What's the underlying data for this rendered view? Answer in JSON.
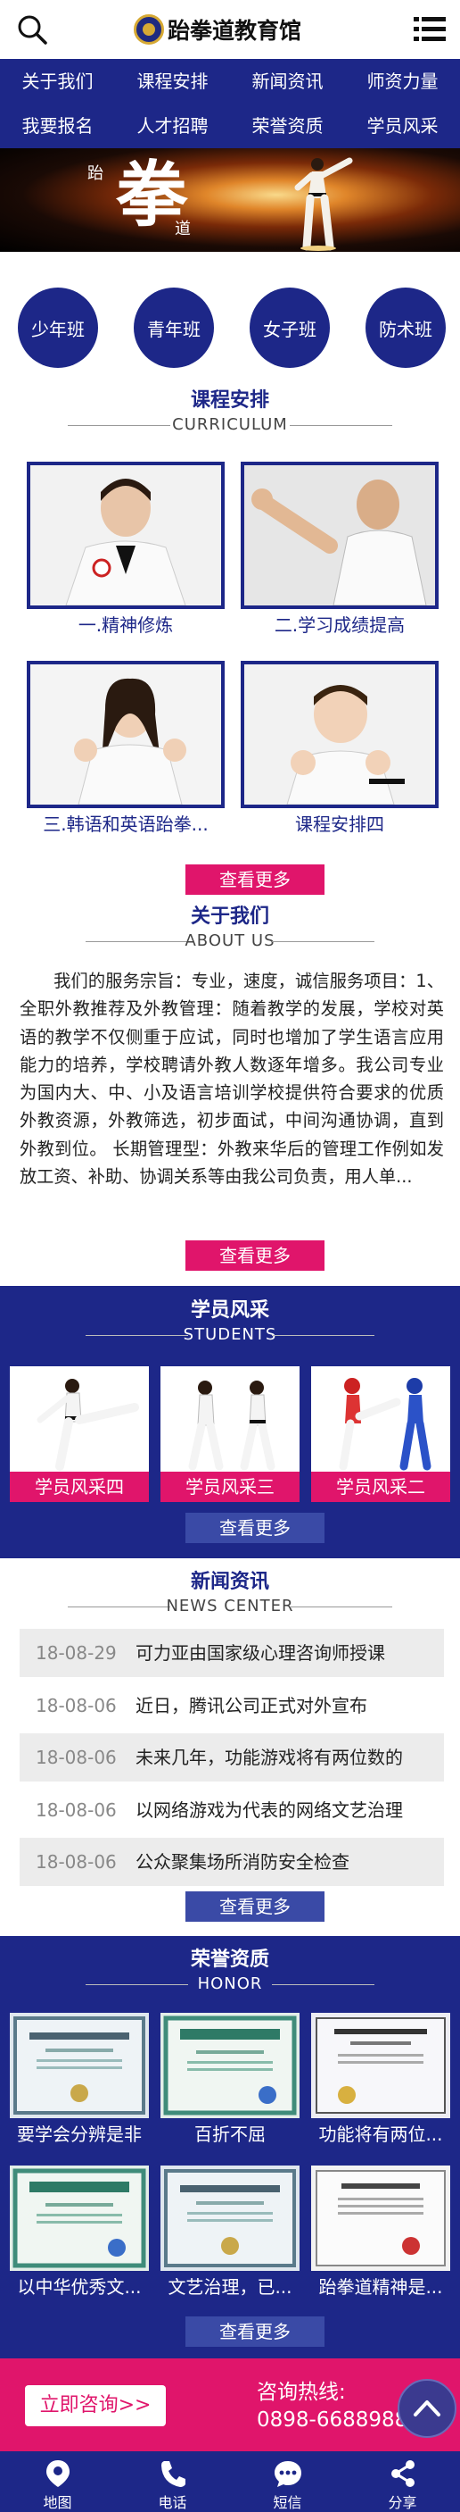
{
  "header": {
    "title": "跆拳道教育馆",
    "search_icon": "search-icon",
    "menu_icon": "menu-icon"
  },
  "nav": [
    "关于我们",
    "课程安排",
    "新闻资讯",
    "师资力量",
    "我要报名",
    "人才招聘",
    "荣誉资质",
    "学员风采"
  ],
  "banner": {
    "main_char": "拳",
    "small_left": "跆",
    "small_right": "道"
  },
  "classes": [
    "少年班",
    "青年班",
    "女子班",
    "防术班"
  ],
  "curriculum": {
    "title": "课程安排",
    "subtitle": "CURRICULUM",
    "items": [
      "一.精神修炼",
      "二.学习成绩提高",
      "三.韩语和英语跆拳...",
      "课程安排四"
    ],
    "more": "查看更多"
  },
  "about": {
    "title": "关于我们",
    "subtitle": "ABOUT US",
    "text": "我们的服务宗旨：专业，速度，诚信服务项目：1、全职外教推荐及外教管理：随着教学的发展，学校对英语的教学不仅侧重于应试，同时也增加了学生语言应用能力的培养，学校聘请外教人数逐年增多。我公司专业为国内大、中、小及语言培训学校提供符合要求的优质外教资源，外教筛选，初步面试，中间沟通协调，直到外教到位。 长期管理型：外教来华后的管理工作例如发放工资、补助、协调关系等由我公司负责，用人单...",
    "more": "查看更多"
  },
  "students": {
    "title": "学员风采",
    "subtitle": "STUDENTS",
    "items": [
      "学员风采四",
      "学员风采三",
      "学员风采二"
    ],
    "more": "查看更多"
  },
  "news": {
    "title": "新闻资讯",
    "subtitle": "NEWS CENTER",
    "items": [
      {
        "date": "18-08-29",
        "title": "可力亚由国家级心理咨询师授课"
      },
      {
        "date": "18-08-06",
        "title": "近日，腾讯公司正式对外宣布"
      },
      {
        "date": "18-08-06",
        "title": "未来几年，功能游戏将有两位数的"
      },
      {
        "date": "18-08-06",
        "title": "以网络游戏为代表的网络文艺治理"
      },
      {
        "date": "18-08-06",
        "title": "公众聚集场所消防安全检查"
      }
    ],
    "more": "查看更多"
  },
  "honor": {
    "title": "荣誉资质",
    "subtitle": "HONOR",
    "items": [
      "要学会分辨是非",
      "百折不屈",
      "功能将有两位...",
      "以中华优秀文...",
      "文艺治理，已...",
      "跆拳道精神是..."
    ],
    "more": "查看更多"
  },
  "consult": {
    "button": "立即咨询>>",
    "hotline_label": "咨询热线:",
    "hotline": "0898-66889888"
  },
  "footer": [
    {
      "label": "地图",
      "icon": "map-pin-icon"
    },
    {
      "label": "电话",
      "icon": "phone-icon"
    },
    {
      "label": "短信",
      "icon": "message-icon"
    },
    {
      "label": "分享",
      "icon": "share-icon"
    }
  ],
  "colors": {
    "primary": "#1d2788",
    "accent": "#e0156b"
  }
}
